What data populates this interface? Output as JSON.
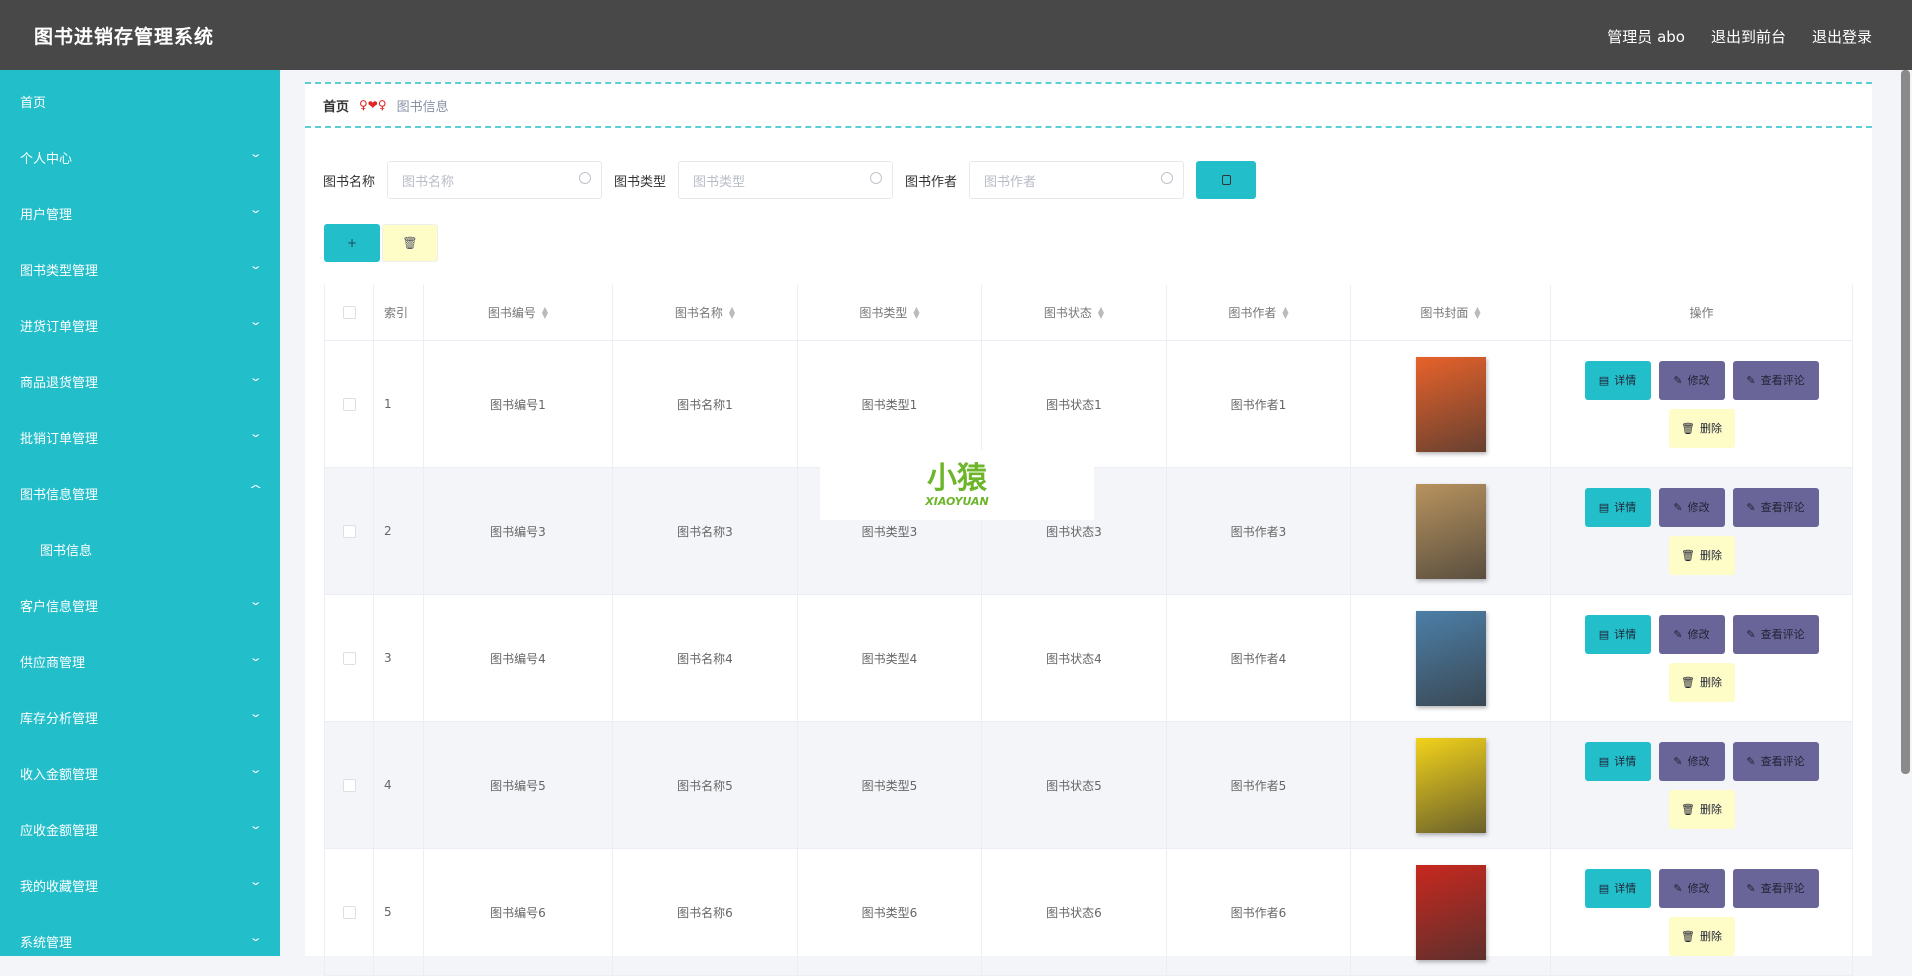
{
  "header": {
    "title": "图书进销存管理系统",
    "user": "管理员 abo",
    "to_front": "退出到前台",
    "logout": "退出登录"
  },
  "sidebar": {
    "items": [
      {
        "label": "首页",
        "chev": ""
      },
      {
        "label": "个人中心",
        "chev": "v"
      },
      {
        "label": "用户管理",
        "chev": "v"
      },
      {
        "label": "图书类型管理",
        "chev": "v"
      },
      {
        "label": "进货订单管理",
        "chev": "v"
      },
      {
        "label": "商品退货管理",
        "chev": "v"
      },
      {
        "label": "批销订单管理",
        "chev": "v"
      },
      {
        "label": "图书信息管理",
        "chev": "^"
      },
      {
        "label": "图书信息",
        "chev": "",
        "sub": true
      },
      {
        "label": "客户信息管理",
        "chev": "v"
      },
      {
        "label": "供应商管理",
        "chev": "v"
      },
      {
        "label": "库存分析管理",
        "chev": "v"
      },
      {
        "label": "收入金额管理",
        "chev": "v"
      },
      {
        "label": "应收金额管理",
        "chev": "v"
      },
      {
        "label": "我的收藏管理",
        "chev": "v"
      },
      {
        "label": "系统管理",
        "chev": "v"
      }
    ]
  },
  "breadcrumb": {
    "home": "首页",
    "sep": "♀❤♀",
    "current": "图书信息"
  },
  "search": {
    "name_label": "图书名称",
    "name_ph": "图书名称",
    "type_label": "图书类型",
    "type_ph": "图书类型",
    "author_label": "图书作者",
    "author_ph": "图书作者"
  },
  "actions": {
    "add": "+",
    "delete": "🗑"
  },
  "table": {
    "headers": [
      "索引",
      "图书编号",
      "图书名称",
      "图书类型",
      "图书状态",
      "图书作者",
      "图书封面",
      "操作"
    ],
    "buttons": {
      "detail": "详情",
      "edit": "修改",
      "comments": "查看评论",
      "delete": "删除"
    },
    "rows": [
      {
        "index": "1",
        "code": "图书编号1",
        "name": "图书名称1",
        "type": "图书类型1",
        "status": "图书状态1",
        "author": "图书作者1",
        "cover": "#e8622a"
      },
      {
        "index": "2",
        "code": "图书编号3",
        "name": "图书名称3",
        "type": "图书类型3",
        "status": "图书状态3",
        "author": "图书作者3",
        "cover": "#b8935e"
      },
      {
        "index": "3",
        "code": "图书编号4",
        "name": "图书名称4",
        "type": "图书类型4",
        "status": "图书状态4",
        "author": "图书作者4",
        "cover": "#4c7fa8"
      },
      {
        "index": "4",
        "code": "图书编号5",
        "name": "图书名称5",
        "type": "图书类型5",
        "status": "图书状态5",
        "author": "图书作者5",
        "cover": "#f2d21a"
      },
      {
        "index": "5",
        "code": "图书编号6",
        "name": "图书名称6",
        "type": "图书类型6",
        "status": "图书状态6",
        "author": "图书作者6",
        "cover": "#c8281e"
      }
    ]
  },
  "watermark": {
    "text": "小猿",
    "sub": "XIAOYUAN"
  }
}
